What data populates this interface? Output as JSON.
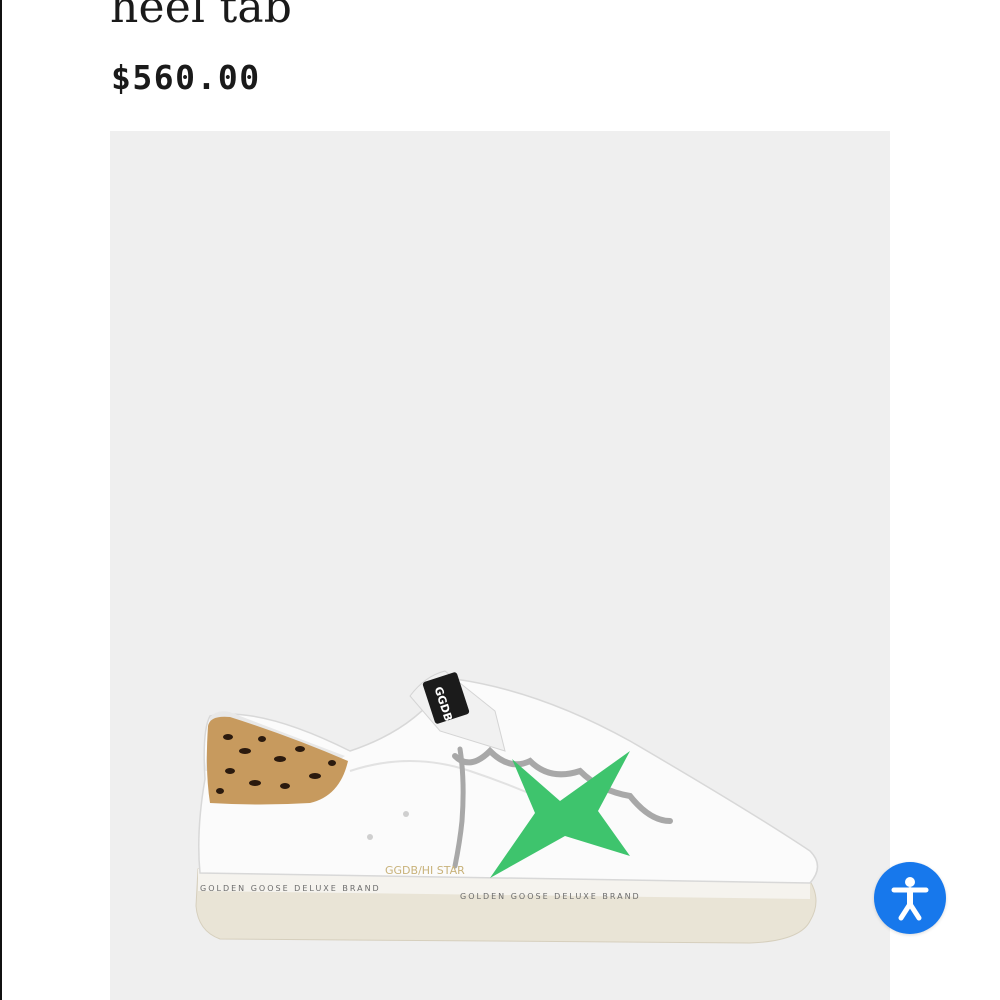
{
  "product": {
    "title": "heel tab",
    "price": "$560.00",
    "image": {
      "label_tongue": "GGDB",
      "label_side": "GGDB/HI STAR",
      "sole_print": "GOLDEN GOOSE DELUXE BRAND",
      "star_color": "#3ec46d"
    }
  },
  "accessibility": {
    "icon": "accessibility-icon",
    "color": "#1778ec"
  }
}
